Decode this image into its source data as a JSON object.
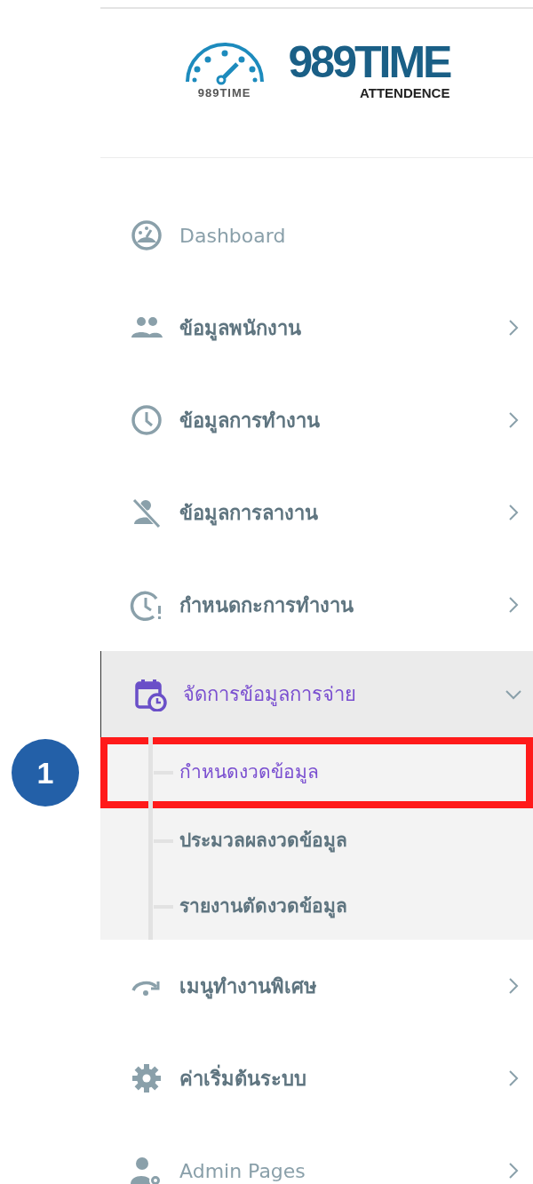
{
  "logo": {
    "emblem_text": "989TIME",
    "title": "989TIME",
    "subtitle": "ATTENDENCE"
  },
  "menu": [
    {
      "label": "Dashboard",
      "has_children": false,
      "expanded": false,
      "selected": false
    },
    {
      "label": "ข้อมูลพนักงาน",
      "has_children": true,
      "expanded": false,
      "selected": false
    },
    {
      "label": "ข้อมูลการทำงาน",
      "has_children": true,
      "expanded": false,
      "selected": false
    },
    {
      "label": "ข้อมูลการลางาน",
      "has_children": true,
      "expanded": false,
      "selected": false
    },
    {
      "label": "กำหนดกะการทำงาน",
      "has_children": true,
      "expanded": false,
      "selected": false
    },
    {
      "label": "จัดการข้อมูลการจ่าย",
      "has_children": true,
      "expanded": true,
      "selected": true,
      "children": [
        {
          "label": "กำหนดงวดข้อมูล",
          "selected": true,
          "highlighted": true,
          "callout": "1"
        },
        {
          "label": "ประมวลผลงวดข้อมูล",
          "selected": false,
          "highlighted": false
        },
        {
          "label": "รายงานตัดงวดข้อมูล",
          "selected": false,
          "highlighted": false
        }
      ]
    },
    {
      "label": "เมนูทำงานพิเศษ",
      "has_children": true,
      "expanded": false,
      "selected": false
    },
    {
      "label": "ค่าเริ่มต้นระบบ",
      "has_children": true,
      "expanded": false,
      "selected": false
    },
    {
      "label": "Admin Pages",
      "has_children": true,
      "expanded": false,
      "selected": false
    }
  ]
}
